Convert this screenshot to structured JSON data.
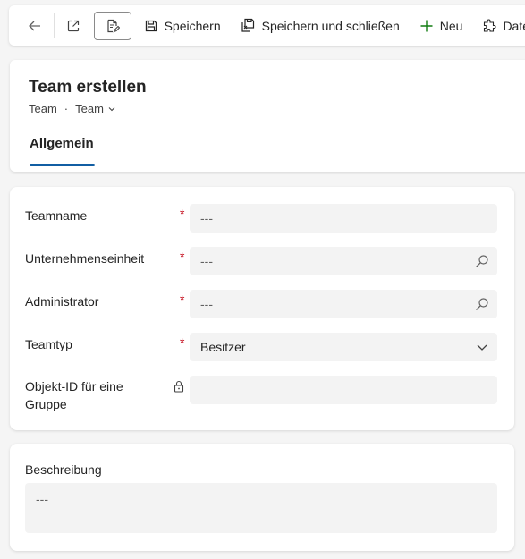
{
  "toolbar": {
    "save_label": "Speichern",
    "save_close_label": "Speichern und schließen",
    "new_label": "Neu",
    "more_label": "Date"
  },
  "header": {
    "title": "Team erstellen",
    "breadcrumb_entity": "Team",
    "breadcrumb_form": "Team",
    "tabs": [
      {
        "label": "Allgemein",
        "selected": true
      }
    ]
  },
  "form": {
    "fields": [
      {
        "label": "Teamname",
        "required": true,
        "value": "---"
      },
      {
        "label": "Unternehmenseinheit",
        "required": true,
        "value": "---",
        "icon": "search-icon"
      },
      {
        "label": "Administrator",
        "required": true,
        "value": "---",
        "icon": "search-icon"
      },
      {
        "label": "Teamtyp",
        "required": true,
        "value": "Besitzer",
        "icon": "chevron-down-icon"
      },
      {
        "label": "Objekt-ID für eine Gruppe",
        "locked": true,
        "value": ""
      }
    ]
  },
  "description": {
    "label": "Beschreibung",
    "value": "---"
  },
  "colors": {
    "accent": "#115ea3",
    "required": "#c50f1f",
    "add_icon": "#107c10"
  }
}
